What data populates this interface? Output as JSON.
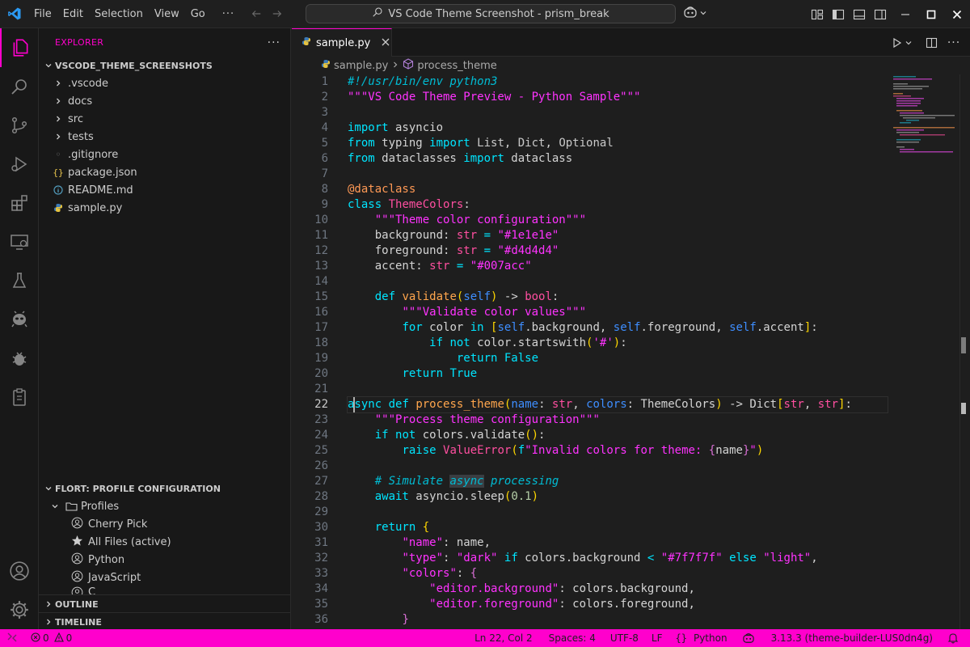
{
  "window": {
    "title": "VS Code Theme Screenshot - prism_break",
    "menu": [
      "File",
      "Edit",
      "Selection",
      "View",
      "Go"
    ],
    "menu_more": "···"
  },
  "colors": {
    "accent": "#ff00cc",
    "statusbar_bg": "#ff00cc",
    "editor_bg": "#1e1e1e",
    "sidebar_bg": "#181818"
  },
  "activity_bar": {
    "items": [
      "explorer-icon",
      "search-icon",
      "source-control-icon",
      "run-debug-icon",
      "extensions-icon",
      "remote-explorer-icon",
      "testing-icon",
      "alien-icon",
      "bug-icon",
      "clipboard-icon"
    ],
    "bottom": [
      "account-icon",
      "manage-gear-icon"
    ]
  },
  "sidebar": {
    "title": "EXPLORER",
    "more": "···",
    "root_folder": "VSCODE_THEME_SCREENSHOTS",
    "folders": [
      ".vscode",
      "docs",
      "src",
      "tests"
    ],
    "files": [
      {
        "name": ".gitignore",
        "icon": "gitignore-icon"
      },
      {
        "name": "package.json",
        "icon": "json-icon"
      },
      {
        "name": "README.md",
        "icon": "info-icon"
      },
      {
        "name": "sample.py",
        "icon": "python-icon"
      }
    ],
    "profile_section": {
      "title": "FLORT: PROFILE CONFIGURATION",
      "folder": "Profiles",
      "items": [
        {
          "label": "Cherry Pick",
          "icon": "account-icon"
        },
        {
          "label": "All Files (active)",
          "icon": "star-icon"
        },
        {
          "label": "Python",
          "icon": "account-icon"
        },
        {
          "label": "JavaScript",
          "icon": "account-icon"
        },
        {
          "label": "C",
          "icon": "account-icon"
        }
      ]
    },
    "outline": "OUTLINE",
    "timeline": "TIMELINE"
  },
  "editor": {
    "tab": {
      "label": "sample.py",
      "close": "×"
    },
    "breadcrumbs": {
      "file": "sample.py",
      "symbol": "process_theme"
    },
    "line_numbers": [
      "1",
      "2",
      "3",
      "4",
      "5",
      "6",
      "7",
      "8",
      "9",
      "10",
      "11",
      "12",
      "13",
      "14",
      "15",
      "16",
      "17",
      "18",
      "19",
      "20",
      "21",
      "22",
      "23",
      "24",
      "25",
      "26",
      "27",
      "28",
      "29",
      "30",
      "31",
      "32",
      "33",
      "34",
      "35",
      "36"
    ],
    "current_line": 22
  },
  "statusbar": {
    "errors": "0",
    "warnings": "0",
    "position": "Ln 22, Col 2",
    "spaces": "Spaces: 4",
    "encoding": "UTF-8",
    "eol": "LF",
    "language_brackets": "{}",
    "language": "Python",
    "interpreter": "3.13.3 (theme-builder-LUS0dn4g)"
  }
}
